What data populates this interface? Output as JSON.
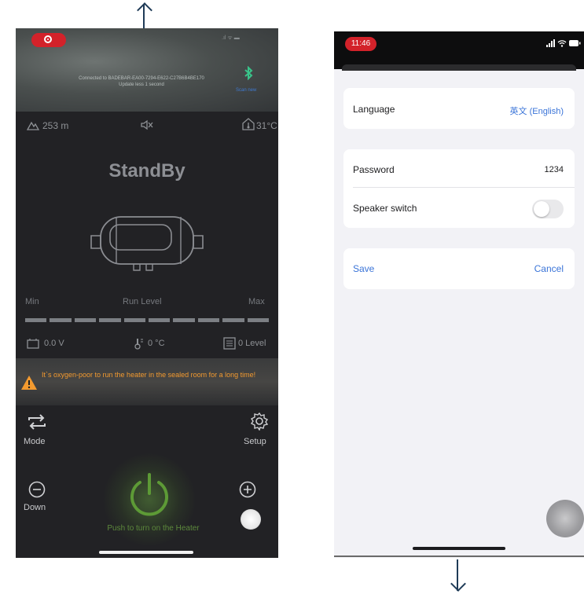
{
  "left_screen": {
    "connection": {
      "line1": "Connected to BADEBAR-EA00-7294-E622-C27B6B4BE170",
      "line2": "Update less 1 second"
    },
    "bluetooth_icon": "bluetooth-icon",
    "scan_link": "Scan new",
    "altitude": "253 m",
    "outside_temp": "31°C",
    "status": "StandBy",
    "run_level": {
      "min": "Min",
      "label": "Run Level",
      "max": "Max",
      "segments": 10
    },
    "voltage": "0.0 V",
    "heater_temp": "0 °C",
    "level": "0 Level",
    "warning": "It`s oxygen-poor to run the heater in the sealed room for a long time!",
    "controls": {
      "mode": "Mode",
      "setup": "Setup",
      "down": "Down"
    },
    "push_text": "Push to turn on the Heater"
  },
  "right_screen": {
    "time": "11:46",
    "language_label": "Language",
    "language_value": "英文 (English)",
    "password_label": "Password",
    "password_value": "1234",
    "speaker_label": "Speaker switch",
    "speaker_on": false,
    "save_label": "Save",
    "cancel_label": "Cancel"
  },
  "colors": {
    "accent_blue": "#3a74d8",
    "warning_orange": "#f39a2f",
    "power_green": "#5d9a36",
    "recording_red": "#d3222a"
  }
}
